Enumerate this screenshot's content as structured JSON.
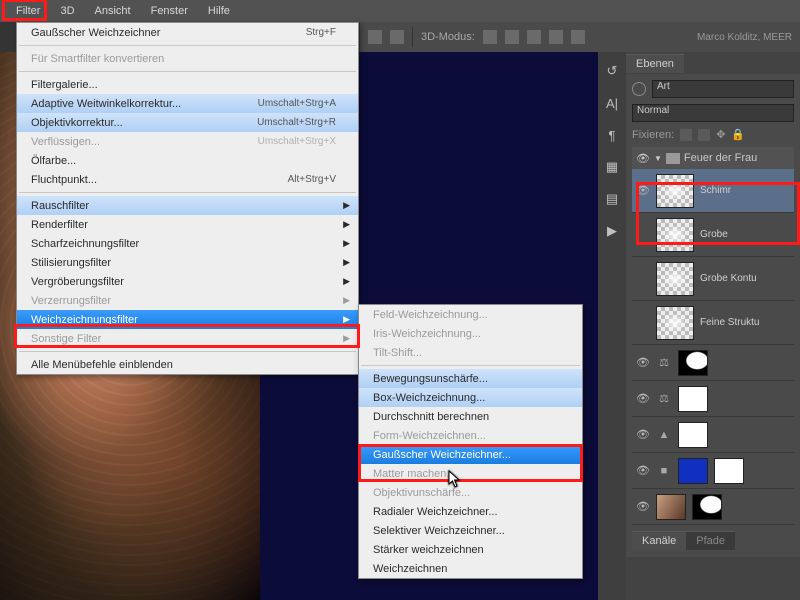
{
  "menubar": {
    "items": [
      "Filter",
      "3D",
      "Ansicht",
      "Fenster",
      "Hilfe"
    ]
  },
  "toolbar": {
    "mode_label": "3D-Modus:",
    "watermark": "Marco Kolditz, MEER"
  },
  "filter_menu": {
    "items": [
      {
        "label": "Gaußscher Weichzeichner",
        "shortcut": "Strg+F",
        "type": "item"
      },
      {
        "type": "sep"
      },
      {
        "label": "Für Smartfilter konvertieren",
        "type": "item",
        "disabled": true
      },
      {
        "type": "sep"
      },
      {
        "label": "Filtergalerie...",
        "type": "item"
      },
      {
        "label": "Adaptive Weitwinkelkorrektur...",
        "shortcut": "Umschalt+Strg+A",
        "type": "item",
        "hl": true
      },
      {
        "label": "Objektivkorrektur...",
        "shortcut": "Umschalt+Strg+R",
        "type": "item",
        "hl": true
      },
      {
        "label": "Verflüssigen...",
        "shortcut": "Umschalt+Strg+X",
        "type": "item",
        "disabled": true
      },
      {
        "label": "Ölfarbe...",
        "type": "item"
      },
      {
        "label": "Fluchtpunkt...",
        "shortcut": "Alt+Strg+V",
        "type": "item"
      },
      {
        "type": "sep"
      },
      {
        "label": "Rauschfilter",
        "type": "sub",
        "hl": true
      },
      {
        "label": "Renderfilter",
        "type": "sub"
      },
      {
        "label": "Scharfzeichnungsfilter",
        "type": "sub"
      },
      {
        "label": "Stilisierungsfilter",
        "type": "sub"
      },
      {
        "label": "Vergröberungsfilter",
        "type": "sub"
      },
      {
        "label": "Verzerrungsfilter",
        "type": "sub",
        "disabled": true
      },
      {
        "label": "Weichzeichnungsfilter",
        "type": "sub",
        "sel": true
      },
      {
        "label": "Sonstige Filter",
        "type": "sub",
        "disabled": true
      },
      {
        "type": "sep"
      },
      {
        "label": "Alle Menübefehle einblenden",
        "type": "item"
      }
    ]
  },
  "submenu": {
    "items": [
      {
        "label": "Feld-Weichzeichnung...",
        "disabled": true
      },
      {
        "label": "Iris-Weichzeichnung...",
        "disabled": true
      },
      {
        "label": "Tilt-Shift...",
        "disabled": true
      },
      {
        "type": "sep"
      },
      {
        "label": "Bewegungsunschärfe...",
        "hl": true
      },
      {
        "label": "Box-Weichzeichnung...",
        "hl": true
      },
      {
        "label": "Durchschnitt berechnen"
      },
      {
        "label": "Form-Weichzeichnen...",
        "disabled": true
      },
      {
        "label": "Gaußscher Weichzeichner...",
        "sel": true
      },
      {
        "label": "Matter machen...",
        "disabled": true
      },
      {
        "label": "Objektivunschärfe...",
        "disabled": true
      },
      {
        "label": "Radialer Weichzeichner..."
      },
      {
        "label": "Selektiver Weichzeichner..."
      },
      {
        "label": "Stärker weichzeichnen"
      },
      {
        "label": "Weichzeichnen"
      }
    ]
  },
  "panels": {
    "layers_tab": "Ebenen",
    "search_kind": "Art",
    "blend": "Normal",
    "lock_label": "Fixieren:",
    "group": "Feuer der Frau",
    "layers": [
      {
        "name": "Schimr",
        "thumb": "wisp",
        "eye": true
      },
      {
        "name": "Grobe",
        "thumb": "wisp",
        "eye": false
      },
      {
        "name": "Grobe Kontu",
        "thumb": "wisp",
        "eye": false
      },
      {
        "name": "Feine Struktu",
        "thumb": "wisp",
        "eye": false
      }
    ],
    "adj_layers": [
      {
        "icon": "⚖",
        "mask": "sil"
      },
      {
        "icon": "⚖",
        "mask": "white"
      },
      {
        "icon": "▲",
        "mask": "white"
      },
      {
        "icon": "■",
        "thumb": "blue",
        "mask": "white"
      },
      {
        "icon": "",
        "thumb": "photo",
        "mask": "sil"
      }
    ],
    "channels_tab": "Kanäle",
    "paths_tab": "Pfade"
  }
}
